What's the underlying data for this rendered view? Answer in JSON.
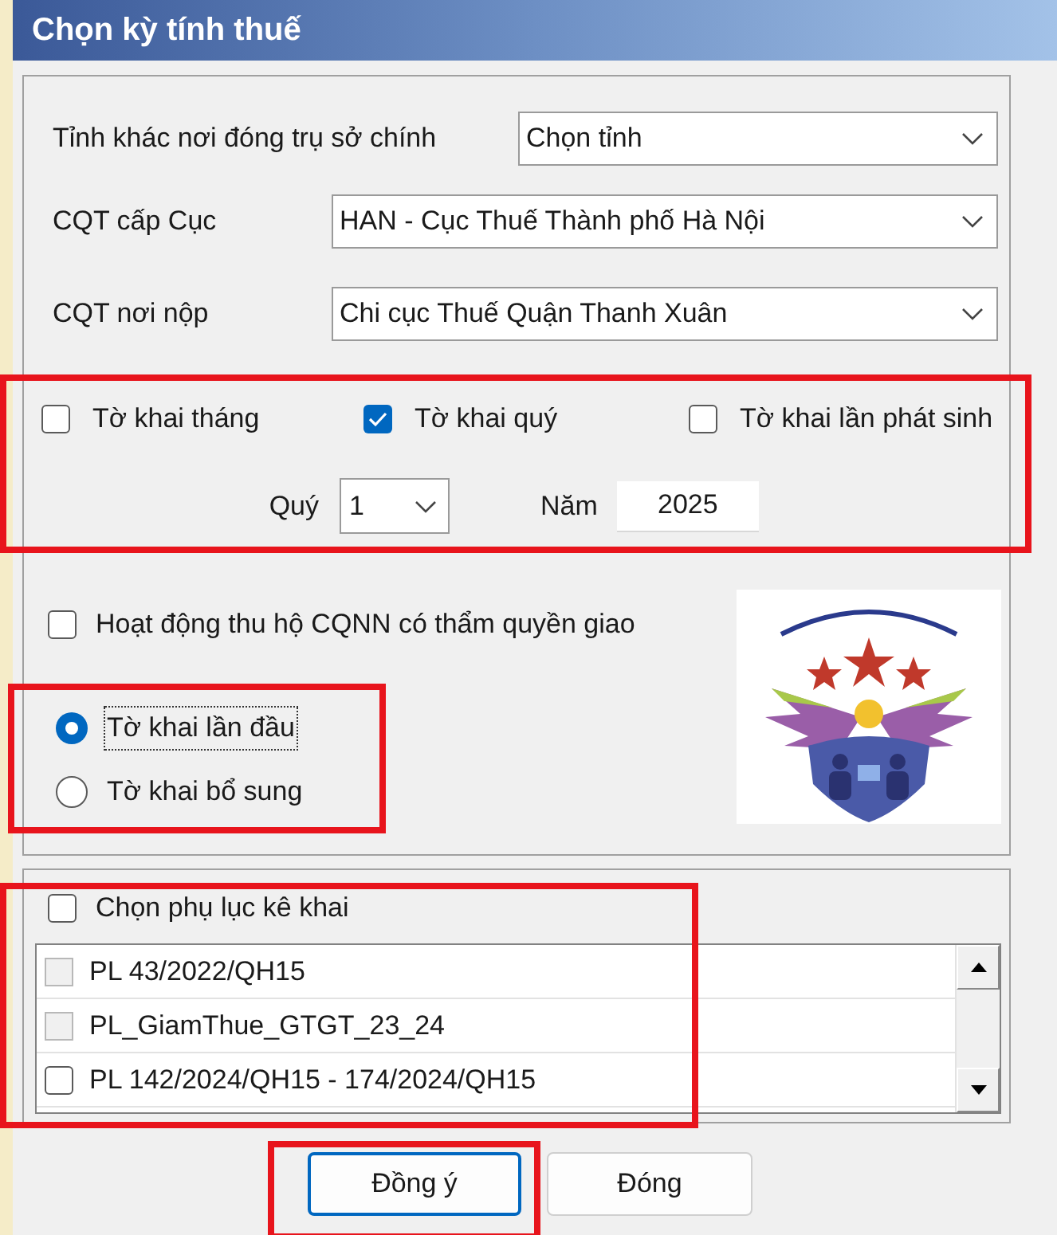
{
  "window": {
    "title": "Chọn kỳ tính thuế"
  },
  "fields": [
    {
      "label": "Tỉnh khác nơi đóng trụ sở chính",
      "value": "Chọn tỉnh"
    },
    {
      "label": "CQT cấp Cục",
      "value": "HAN - Cục Thuế Thành phố Hà Nội"
    },
    {
      "label": "CQT nơi nộp",
      "value": "Chi cục Thuế Quận Thanh Xuân"
    }
  ],
  "declaration_types": [
    {
      "label": "Tờ khai tháng",
      "checked": false
    },
    {
      "label": "Tờ khai quý",
      "checked": true
    },
    {
      "label": "Tờ khai lần phát sinh",
      "checked": false
    }
  ],
  "period": {
    "quarter_label": "Quý",
    "quarter": "1",
    "year_label": "Năm",
    "year": "2025"
  },
  "collection_option": {
    "label": "Hoạt động thu hộ CQNN có thẩm quyền giao",
    "checked": false
  },
  "submission": [
    {
      "label": "Tờ khai lần đầu",
      "selected": true
    },
    {
      "label": "Tờ khai bổ sung",
      "selected": false
    }
  ],
  "appendix": {
    "label": "Chọn phụ lục kê khai",
    "checked": false,
    "items": [
      {
        "label": "PL 43/2022/QH15",
        "checked": false,
        "disabled": true
      },
      {
        "label": "PL_GiamThue_GTGT_23_24",
        "checked": false,
        "disabled": true
      },
      {
        "label": "PL 142/2024/QH15 - 174/2024/QH15",
        "checked": false,
        "disabled": false
      }
    ]
  },
  "buttons": [
    {
      "label": "Đồng ý",
      "default": true
    },
    {
      "label": "Đóng",
      "default": false
    }
  ]
}
